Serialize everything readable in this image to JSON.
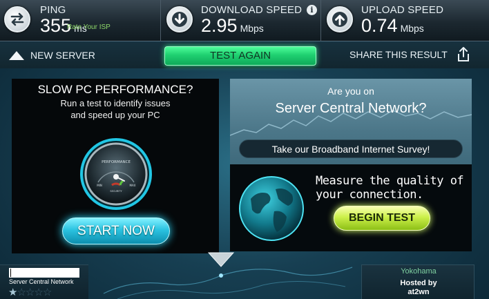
{
  "stats": {
    "ping": {
      "label": "PING",
      "value": "355",
      "unit": "ms"
    },
    "download": {
      "label": "DOWNLOAD SPEED",
      "value": "2.95",
      "unit": "Mbps",
      "info_icon": "info-icon"
    },
    "upload": {
      "label": "UPLOAD SPEED",
      "value": "0.74",
      "unit": "Mbps"
    }
  },
  "actions": {
    "new_server": "NEW SERVER",
    "test_again": "TEST AGAIN",
    "share": "SHARE THIS RESULT"
  },
  "ad_left": {
    "title": "SLOW PC PERFORMANCE?",
    "line1": "Run a test to identify issues",
    "line2": "and speed up your PC",
    "gauge_label": "PERFORMANCE",
    "gauge_min": "MIN",
    "gauge_max": "MAX",
    "gauge_security": "SECURITY",
    "cta": "START NOW"
  },
  "ad_right": {
    "question_line1": "Are you on",
    "question_line2": "Server Central Network?",
    "survey_cta": "Take our Broadband Internet Survey!",
    "measure_line1": "Measure the quality of",
    "measure_line2": "your connection.",
    "cta": "BEGIN TEST"
  },
  "footer": {
    "isp_name": "Server Central Network",
    "rating_stars_filled": 1,
    "rating_stars_total": 5,
    "rate_isp": "Rate Your ISP",
    "server_city": "Yokohama",
    "hosted_by_label": "Hosted by",
    "host_name": "at2wn"
  },
  "colors": {
    "test_again": "#1fd070",
    "start_now": "#2bc3e1",
    "begin_test": "#ccf04a",
    "background": "#173f52"
  }
}
